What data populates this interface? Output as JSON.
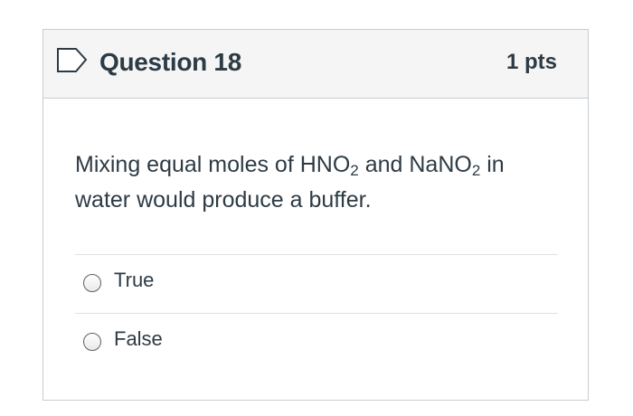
{
  "question": {
    "title": "Question 18",
    "points": "1 pts",
    "text_parts": {
      "p1": "Mixing equal moles of HNO",
      "sub1": "2",
      "p2": " and NaNO",
      "sub2": "2",
      "p3": " in water would produce a buffer."
    },
    "flag_icon": "bookmark-flag-icon",
    "answers": [
      {
        "label": "True",
        "selected": false
      },
      {
        "label": "False",
        "selected": false
      }
    ]
  },
  "colors": {
    "header_bg": "#f5f5f5",
    "border": "#c7cdd1",
    "text": "#2d3b45",
    "flag": "#2d3b45"
  }
}
